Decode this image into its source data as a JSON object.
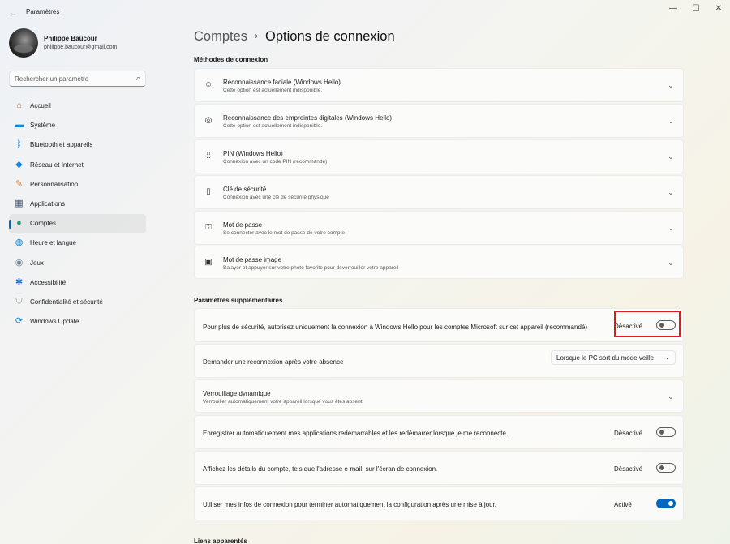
{
  "window": {
    "title": "Paramètres",
    "back_icon": "back-arrow-icon"
  },
  "profile": {
    "name": "Philippe Baucour",
    "email": "philippe.baucour@gmail.com"
  },
  "search": {
    "placeholder": "Rechercher un paramètre"
  },
  "sidebar": {
    "items": [
      {
        "label": "Accueil",
        "icon": "home-icon",
        "color": "#c27a2c"
      },
      {
        "label": "Système",
        "icon": "system-icon",
        "color": "#1a86d6"
      },
      {
        "label": "Bluetooth et appareils",
        "icon": "bluetooth-icon",
        "color": "#1a86d6"
      },
      {
        "label": "Réseau et Internet",
        "icon": "network-icon",
        "color": "#1a86d6"
      },
      {
        "label": "Personnalisation",
        "icon": "brush-icon",
        "color": "#d9822b"
      },
      {
        "label": "Applications",
        "icon": "apps-icon",
        "color": "#4a5a7a"
      },
      {
        "label": "Comptes",
        "icon": "accounts-icon",
        "color": "#1e9e6a",
        "active": true
      },
      {
        "label": "Heure et langue",
        "icon": "globe-icon",
        "color": "#1a86d6"
      },
      {
        "label": "Jeux",
        "icon": "gamepad-icon",
        "color": "#7a8a9a"
      },
      {
        "label": "Accessibilité",
        "icon": "accessibility-icon",
        "color": "#1a6ed6"
      },
      {
        "label": "Confidentialité et sécurité",
        "icon": "shield-icon",
        "color": "#8a8a8a"
      },
      {
        "label": "Windows Update",
        "icon": "update-icon",
        "color": "#1a86d6"
      }
    ]
  },
  "breadcrumb": {
    "parent": "Comptes",
    "separator": "›",
    "current": "Options de connexion"
  },
  "methods": {
    "title": "Méthodes de connexion",
    "items": [
      {
        "title": "Reconnaissance faciale (Windows Hello)",
        "subtitle": "Cette option est actuellement indisponible.",
        "icon": "face-icon"
      },
      {
        "title": "Reconnaissance des empreintes digitales (Windows Hello)",
        "subtitle": "Cette option est actuellement indisponible.",
        "icon": "fingerprint-icon"
      },
      {
        "title": "PIN (Windows Hello)",
        "subtitle": "Connexion avec un code PIN (recommandé)",
        "icon": "pin-icon"
      },
      {
        "title": "Clé de sécurité",
        "subtitle": "Connexion avec une clé de sécurité physique",
        "icon": "usb-key-icon"
      },
      {
        "title": "Mot de passe",
        "subtitle": "Se connecter avec le mot de passe de votre compte",
        "icon": "key-icon"
      },
      {
        "title": "Mot de passe image",
        "subtitle": "Balayer et appuyer sur votre photo favorite pour déverrouiller votre appareil",
        "icon": "image-icon"
      }
    ]
  },
  "additional": {
    "title": "Paramètres supplémentaires",
    "hello_only": {
      "label": "Pour plus de sécurité, autorisez uniquement la connexion à Windows Hello pour les comptes Microsoft sur cet appareil (recommandé)",
      "state": "Désactivé",
      "on": false
    },
    "reconnect": {
      "label": "Demander une reconnexion après votre absence",
      "value": "Lorsque le PC sort du mode veille"
    },
    "dynamic_lock": {
      "title": "Verrouillage dynamique",
      "subtitle": "Verrouiller automatiquement votre appareil lorsque vous êtes absent"
    },
    "restart_apps": {
      "label": "Enregistrer automatiquement mes applications redémarrables et les redémarrer lorsque je me reconnecte.",
      "state": "Désactivé",
      "on": false
    },
    "account_details": {
      "label": "Affichez les détails du compte, tels que l'adresse e-mail, sur l'écran de connexion.",
      "state": "Désactivé",
      "on": false
    },
    "use_signin_info": {
      "label": "Utiliser mes infos de connexion pour terminer automatiquement la configuration après une mise à jour.",
      "state": "Activé",
      "on": true
    }
  },
  "related": {
    "title": "Liens apparentés"
  },
  "colors": {
    "accent": "#0067c0",
    "highlight": "#e11919"
  }
}
